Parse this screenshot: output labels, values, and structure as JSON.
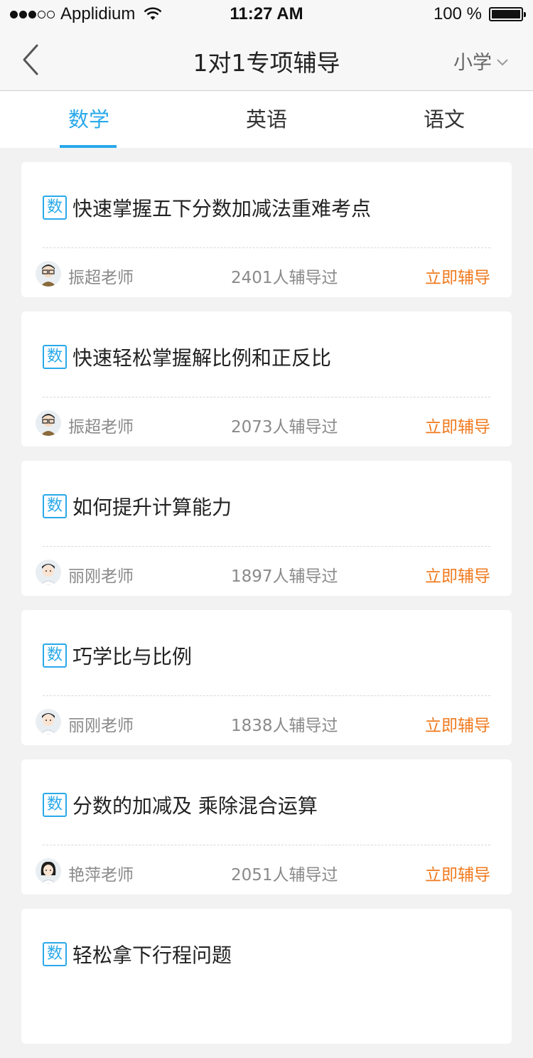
{
  "status_bar": {
    "carrier": "Applidium",
    "time": "11:27 AM",
    "battery": "100 %"
  },
  "nav": {
    "title": "1对1专项辅导",
    "grade": "小学"
  },
  "tabs": [
    {
      "label": "数学",
      "active": true
    },
    {
      "label": "英语",
      "active": false
    },
    {
      "label": "语文",
      "active": false
    }
  ],
  "accent_color": "#29a9ea",
  "action_color": "#f07a1e",
  "courses": [
    {
      "badge": "数",
      "title": "快速掌握五下分数加减法重难考点",
      "teacher": "振超老师",
      "count": "2401人辅导过",
      "action": "立即辅导",
      "avatar": "male-teacher-glasses-avatar"
    },
    {
      "badge": "数",
      "title": "快速轻松掌握解比例和正反比",
      "teacher": "振超老师",
      "count": "2073人辅导过",
      "action": "立即辅导",
      "avatar": "male-teacher-glasses-avatar"
    },
    {
      "badge": "数",
      "title": "如何提升计算能力",
      "teacher": "丽刚老师",
      "count": "1897人辅导过",
      "action": "立即辅导",
      "avatar": "male-teacher-avatar"
    },
    {
      "badge": "数",
      "title": "巧学比与比例",
      "teacher": "丽刚老师",
      "count": "1838人辅导过",
      "action": "立即辅导",
      "avatar": "male-teacher-avatar"
    },
    {
      "badge": "数",
      "title": "分数的加减及 乘除混合运算",
      "teacher": "艳萍老师",
      "count": "2051人辅导过",
      "action": "立即辅导",
      "avatar": "female-teacher-avatar"
    },
    {
      "badge": "数",
      "title": "轻松拿下行程问题",
      "teacher": "",
      "count": "",
      "action": "",
      "avatar": ""
    }
  ]
}
